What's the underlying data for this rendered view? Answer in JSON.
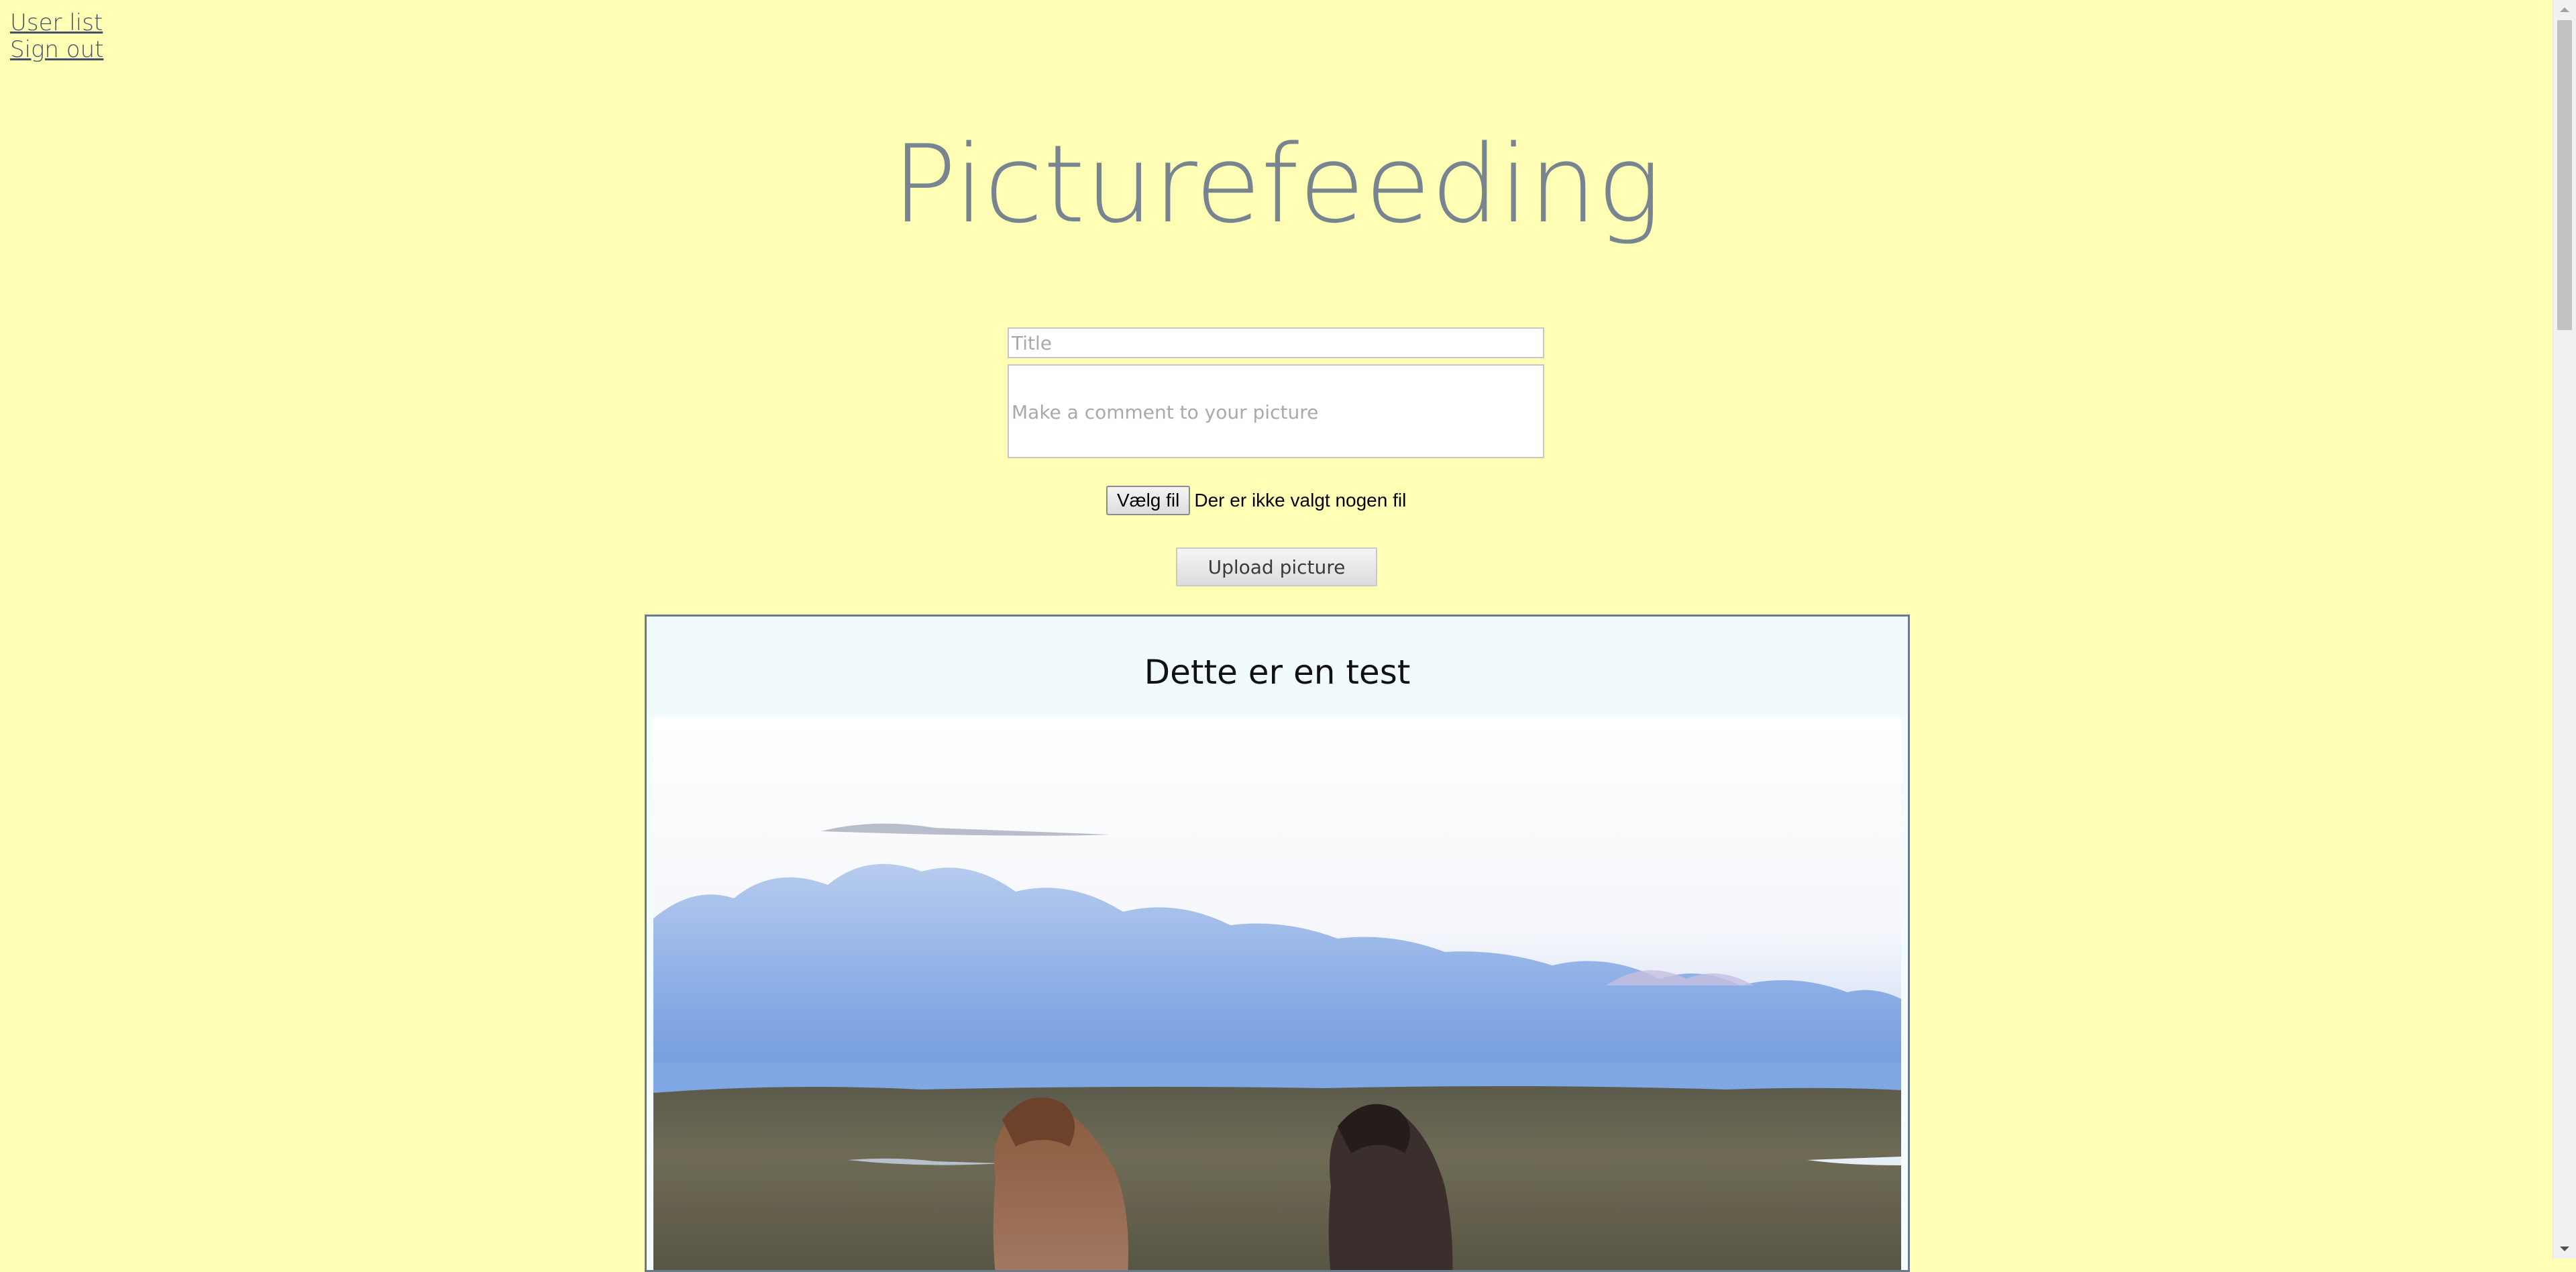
{
  "nav": {
    "user_list": "User list",
    "sign_out": "Sign out"
  },
  "header": {
    "title": "Picturefeeding"
  },
  "upload_form": {
    "title_placeholder": "Title",
    "comment_placeholder": "Make a comment to your picture",
    "file_button_label": "Vælg fil",
    "file_status": "Der er ikke valgt nogen fil",
    "upload_button_label": "Upload picture"
  },
  "feed": {
    "posts": [
      {
        "title": "Dette er en test",
        "image": "photo of two horses grazing on a field under a cloudy sky"
      }
    ]
  },
  "colors": {
    "page_background": "#fefeb4",
    "title_color": "#788490",
    "post_background": "#f3fcfe",
    "post_border": "#6b7a88"
  }
}
